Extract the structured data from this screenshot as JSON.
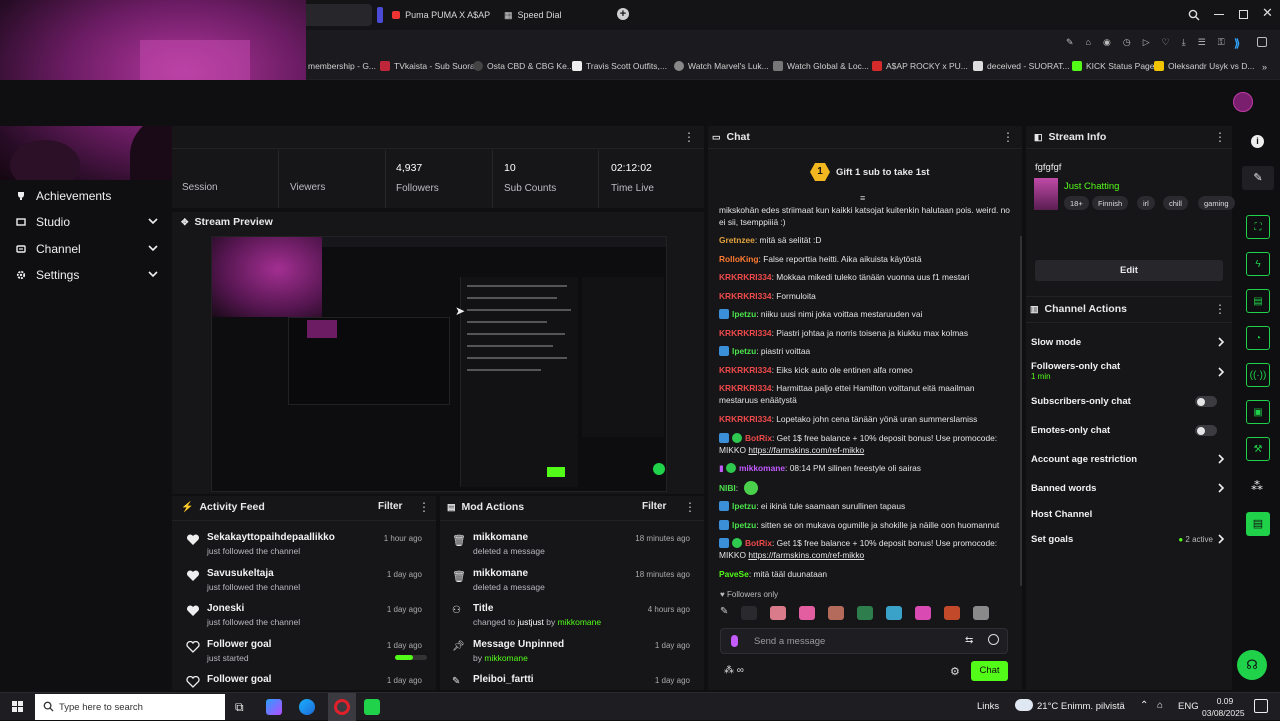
{
  "browser": {
    "tabs": [
      {
        "label": "Puma PUMA X A$AP ROC"
      },
      {
        "label": "Speed Dial"
      }
    ],
    "bookmarks": [
      {
        "label": "membership - G..."
      },
      {
        "label": "TVkaista - Sub Suora"
      },
      {
        "label": "Osta CBD & CBG Ke..."
      },
      {
        "label": "Travis Scott Outfits,..."
      },
      {
        "label": "Watch Marvel's Luk..."
      },
      {
        "label": "Watch Global & Loc..."
      },
      {
        "label": "A$AP ROCKY x PU..."
      },
      {
        "label": "deceived - SUORAT..."
      },
      {
        "label": "KICK Status Page"
      },
      {
        "label": "Oleksandr Usyk vs D..."
      }
    ]
  },
  "stats": [
    {
      "label": "Session",
      "value": ""
    },
    {
      "label": "Viewers",
      "value": ""
    },
    {
      "label": "Followers",
      "value": "4,937"
    },
    {
      "label": "Sub Counts",
      "value": "10"
    },
    {
      "label": "Time Live",
      "value": "02:12:02"
    }
  ],
  "sidebar": {
    "items": [
      {
        "label": "Achievements",
        "icon": "trophy-icon"
      },
      {
        "label": "Studio",
        "icon": "studio-icon"
      },
      {
        "label": "Channel",
        "icon": "channel-icon"
      },
      {
        "label": "Settings",
        "icon": "gear-icon"
      }
    ]
  },
  "preview": {
    "title": "Stream Preview"
  },
  "activity": {
    "title": "Activity Feed",
    "filter_label": "Filter",
    "items": [
      {
        "name": "Sekakayttopaihdepaallikko",
        "sub": "just followed the channel",
        "time": "1 hour ago",
        "icon": "heart-filled-icon"
      },
      {
        "name": "Savusukeltaja",
        "sub": "just followed the channel",
        "time": "1 day ago",
        "icon": "heart-filled-icon"
      },
      {
        "name": "Joneski",
        "sub": "just followed the channel",
        "time": "1 day ago",
        "icon": "heart-filled-icon"
      },
      {
        "name": "Follower goal",
        "sub": "just started",
        "time": "1 day ago",
        "icon": "heart-outline-icon",
        "progress": 0.55
      },
      {
        "name": "Follower goal",
        "sub": "",
        "time": "1 day ago",
        "icon": "heart-outline-icon"
      }
    ]
  },
  "mod": {
    "title": "Mod Actions",
    "filter_label": "Filter",
    "items": [
      {
        "name": "mikkomane",
        "sub": "deleted a message",
        "time": "18 minutes ago",
        "icon": "trash-icon"
      },
      {
        "name": "mikkomane",
        "sub": "deleted a message",
        "time": "18 minutes ago",
        "icon": "trash-icon"
      },
      {
        "name": "Title",
        "sub_pre": "changed to",
        "sub_mid": "justjust",
        "sub_by": "by",
        "sub_user": "mikkomane",
        "time": "4 hours ago",
        "icon": "users-icon"
      },
      {
        "name": "Message Unpinned",
        "sub_by": "by",
        "sub_user": "mikkomane",
        "time": "1 day ago",
        "icon": "pin-icon"
      },
      {
        "name": "Pleiboi_fartti",
        "sub": "",
        "time": "1 day ago",
        "icon": "pencil-icon"
      }
    ]
  },
  "chat": {
    "title": "Chat",
    "gift_text": "Gift 1 sub to take 1st",
    "gift_count": "1",
    "messages": [
      {
        "user": "",
        "text": "mikskohän edes striimaat kun kaikki katsojat kuitenkin halutaan pois. weird. no ei sii, tsemppiiiä :)"
      },
      {
        "user": "Gretnzee",
        "text": "mitä sä selität :D"
      },
      {
        "user": "RolloKing",
        "text": "False reporttia heitti. Aika aikuista käytöstä"
      },
      {
        "user": "KRKRKRI334",
        "text": "Mokkaa mikedi tuleko tänään vuonna uus f1 mestari"
      },
      {
        "user": "KRKRKRI334",
        "text": "Formuloita"
      },
      {
        "user": "lpetzu",
        "text": "niiku uusi nimi joka voittaa mestaruuden vai"
      },
      {
        "user": "KRKRKRI334",
        "text": "Piastri johtaa ja norris toisena ja kiukku max kolmas"
      },
      {
        "user": "lpetzu",
        "text": "piastri voittaa"
      },
      {
        "user": "KRKRKRI334",
        "text": "Eiks kick auto ole entinen alfa romeo"
      },
      {
        "user": "KRKRKRI334",
        "text": "Harmittaa paljo ettei Hamilton voittanut eitä maailman mestaruus enäätystä"
      },
      {
        "user": "KRKRKRI334",
        "text": "Lopetako john cena tänään yönä uran summerslamiss"
      },
      {
        "user": "BotRix",
        "text": "Get 1$ free balance + 10% deposit bonus! Use promocode: MIKKO",
        "link": "https://farmskins.com/ref-mikko"
      },
      {
        "user": "mikkomane",
        "text": "08:14 PM silinen freestyle oli sairas"
      },
      {
        "user": "NIBI",
        "text": ""
      },
      {
        "user": "lpetzu",
        "text": "ei ikinä tule saamaan surullinen tapaus"
      },
      {
        "user": "lpetzu",
        "text": "sitten se on mukava ogumille ja shokille ja näille oon huomannut"
      },
      {
        "user": "BotRix",
        "text": "Get 1$ free balance + 10% deposit bonus! Use promocode: MIKKO",
        "link": "https://farmskins.com/ref-mikko"
      },
      {
        "user": "PaveSe",
        "text": "mitä tääl duunataan"
      }
    ],
    "followers_only": "Followers only",
    "input_placeholder": "Send a message",
    "send_label": "Chat"
  },
  "stream_info": {
    "title": "Stream Info",
    "stream_title": "fgfgfgf",
    "category": "Just Chatting",
    "tags": [
      "18+",
      "Finnish",
      "irl",
      "chill",
      "gaming"
    ],
    "edit_label": "Edit"
  },
  "channel_actions": {
    "title": "Channel Actions",
    "items": [
      {
        "label": "Slow mode",
        "control": "arrow"
      },
      {
        "label": "Followers-only chat",
        "sub": "1 min",
        "control": "arrow"
      },
      {
        "label": "Subscribers-only chat",
        "control": "toggle"
      },
      {
        "label": "Emotes-only chat",
        "control": "toggle"
      },
      {
        "label": "Account age restriction",
        "control": "arrow"
      },
      {
        "label": "Banned words",
        "control": "arrow"
      },
      {
        "label": "Host Channel",
        "control": "none"
      },
      {
        "label": "Set goals",
        "badge": "2 active",
        "control": "arrow"
      }
    ]
  },
  "taskbar": {
    "search_placeholder": "Type here to search",
    "links_label": "Links",
    "weather": "21°C Enimm. pilvistä",
    "lang": "ENG",
    "time": "0.09",
    "date": "03/08/2025"
  },
  "colors": {
    "accent": "#53fc18",
    "bg": "#0f0f11",
    "panel": "#161619",
    "kick_green": "#1fd24a"
  }
}
